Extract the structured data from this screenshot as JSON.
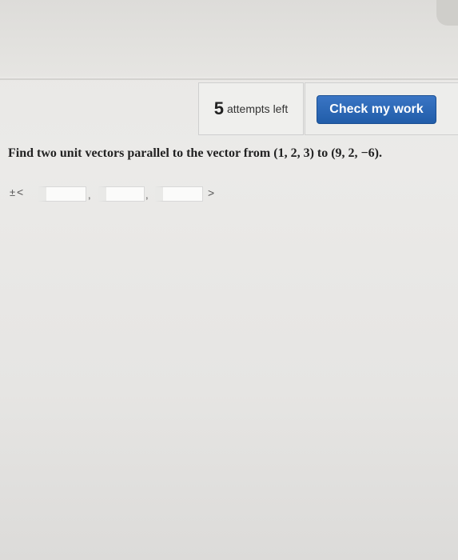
{
  "toolbar": {
    "attempts_count": "5",
    "attempts_label": "attempts left",
    "check_button_label": "Check my work"
  },
  "question": {
    "text": "Find two unit vectors parallel to the vector from (1, 2, 3) to (9, 2, −6)."
  },
  "answer": {
    "prefix_pm": "±",
    "open_bracket": "<",
    "separator": ",",
    "close_bracket": ">",
    "values": [
      "",
      "",
      ""
    ]
  },
  "colors": {
    "button_blue": "#2a64b0",
    "background": "#ebeae8"
  }
}
